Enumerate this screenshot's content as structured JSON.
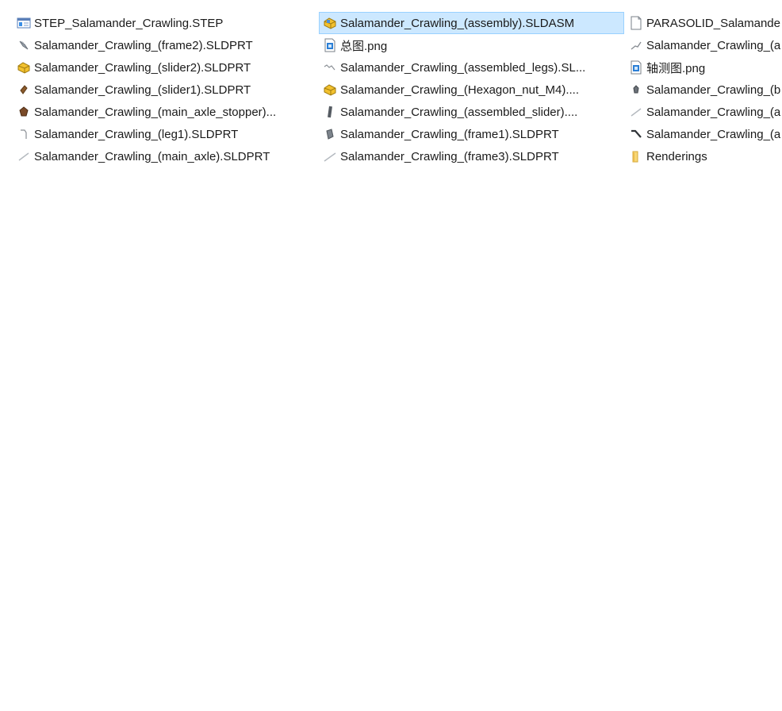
{
  "files": {
    "column1": [
      {
        "name": "STEP_Salamander_Crawling.STEP",
        "icon": "step-file-icon"
      },
      {
        "name": "Salamander_Crawling_(frame2).SLDPRT",
        "icon": "part-file-icon"
      },
      {
        "name": "Salamander_Crawling_(slider2).SLDPRT",
        "icon": "assembly-part-icon"
      },
      {
        "name": "Salamander_Crawling_(slider1).SLDPRT",
        "icon": "part-file-icon"
      },
      {
        "name": "Salamander_Crawling_(main_axle_stopper)...",
        "icon": "part-file-icon"
      },
      {
        "name": "Salamander_Crawling_(leg1).SLDPRT",
        "icon": "part-file-icon"
      },
      {
        "name": "Salamander_Crawling_(main_axle).SLDPRT",
        "icon": "part-file-icon"
      }
    ],
    "column2": [
      {
        "name": "Salamander_Crawling_(assembly).SLDASM",
        "icon": "assembly-file-icon",
        "selected": true
      },
      {
        "name": "总图.png",
        "icon": "png-image-icon"
      },
      {
        "name": "Salamander_Crawling_(assembled_legs).SL...",
        "icon": "part-file-icon"
      },
      {
        "name": "Salamander_Crawling_(Hexagon_nut_M4)....",
        "icon": "assembly-part-icon"
      },
      {
        "name": "Salamander_Crawling_(assembled_slider)....",
        "icon": "part-file-icon"
      },
      {
        "name": "Salamander_Crawling_(frame1).SLDPRT",
        "icon": "part-file-icon"
      },
      {
        "name": "Salamander_Crawling_(frame3).SLDPRT",
        "icon": "part-file-icon"
      }
    ],
    "column3": [
      {
        "name": "PARASOLID_Salamande",
        "icon": "blank-file-icon"
      },
      {
        "name": "Salamander_Crawling_(a",
        "icon": "part-file-icon"
      },
      {
        "name": "轴测图.png",
        "icon": "png-image-icon"
      },
      {
        "name": "Salamander_Crawling_(b",
        "icon": "part-file-icon"
      },
      {
        "name": "Salamander_Crawling_(a",
        "icon": "part-file-icon"
      },
      {
        "name": "Salamander_Crawling_(a",
        "icon": "part-file-icon"
      },
      {
        "name": "Renderings",
        "icon": "folder-icon"
      }
    ]
  },
  "colors": {
    "selection_bg": "#cce8ff",
    "selection_border": "#99d1ff",
    "folder_yellow": "#f8d775",
    "assembly_yellow": "#f2c12e"
  }
}
